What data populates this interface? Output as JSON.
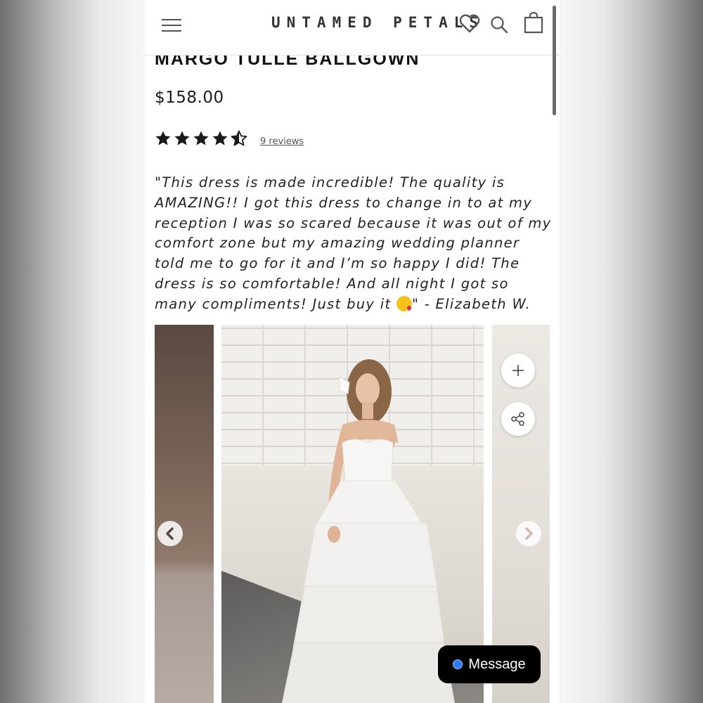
{
  "header": {
    "brand": "UNTAMED PETALS",
    "icons": [
      "menu-icon",
      "heart-icon",
      "search-icon",
      "cart-icon"
    ]
  },
  "product": {
    "title": "MARGO TULLE BALLGOWN",
    "price": "$158.00",
    "rating": {
      "stars": 4.5,
      "max": 5
    },
    "reviews_label": "9 reviews",
    "quote_before_emoji": "\"This dress is made incredible! The quality is AMAZING!! I got this dress to change in to at my reception I was so scared because it was out of my comfort zone but my amazing wedding planner told me to go for it and I’m so happy I did! The dress is so comfortable! And all night I got so many compliments! Just buy it ",
    "quote_emoji": "face-blowing-a-kiss",
    "quote_after_emoji": "\" - Elizabeth W."
  },
  "gallery": {
    "icons": [
      "plus-icon",
      "share-icon",
      "chevron-left-icon",
      "chevron-right-icon"
    ]
  },
  "chat": {
    "message_label": "Message",
    "dot_color": "#2f7bf5"
  },
  "colors": {
    "text": "#111111",
    "background": "#ffffff"
  }
}
